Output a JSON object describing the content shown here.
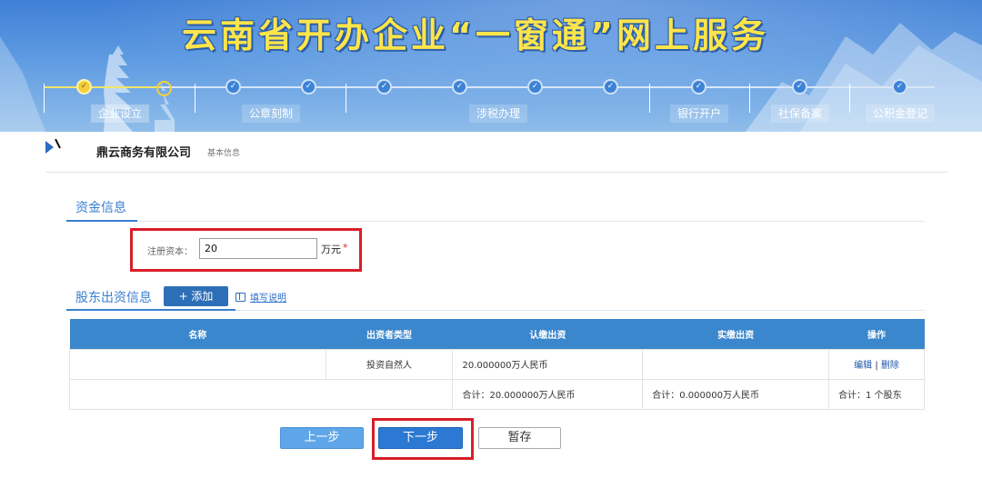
{
  "header": {
    "title": "云南省开办企业“一窗通”网上服务",
    "stages": [
      "企业设立",
      "公章刻制",
      "涉税办理",
      "银行开户",
      "社保备案",
      "公积金登记"
    ]
  },
  "company": {
    "name": "鼎云商务有限公司",
    "subtitle": "基本信息"
  },
  "capital_section": {
    "title": "资金信息",
    "field_label": "注册资本：",
    "value": "20",
    "unit": "万元",
    "required_mark": "*"
  },
  "shareholder_section": {
    "title": "股东出资信息",
    "add_label": "+ 添加",
    "help_label": "填写说明"
  },
  "table": {
    "columns": [
      "名称",
      "出资者类型",
      "认缴出资",
      "实缴出资",
      "操作"
    ],
    "rows": [
      {
        "name": "",
        "type": "投资自然人",
        "subscribed": "20.000000万人民币",
        "paid": "",
        "edit": "编辑",
        "sep": "|",
        "delete": "删除"
      }
    ],
    "totals": {
      "subscribed": "合计：20.000000万人民币",
      "paid": "合计：0.000000万人民币",
      "count": "合计：1 个股东"
    }
  },
  "buttons": {
    "prev": "上一步",
    "next": "下一步",
    "save": "暂存"
  },
  "colors": {
    "accent": "#3b87cd",
    "highlight_box": "#d81e28",
    "title_yellow": "#ffe44a"
  }
}
